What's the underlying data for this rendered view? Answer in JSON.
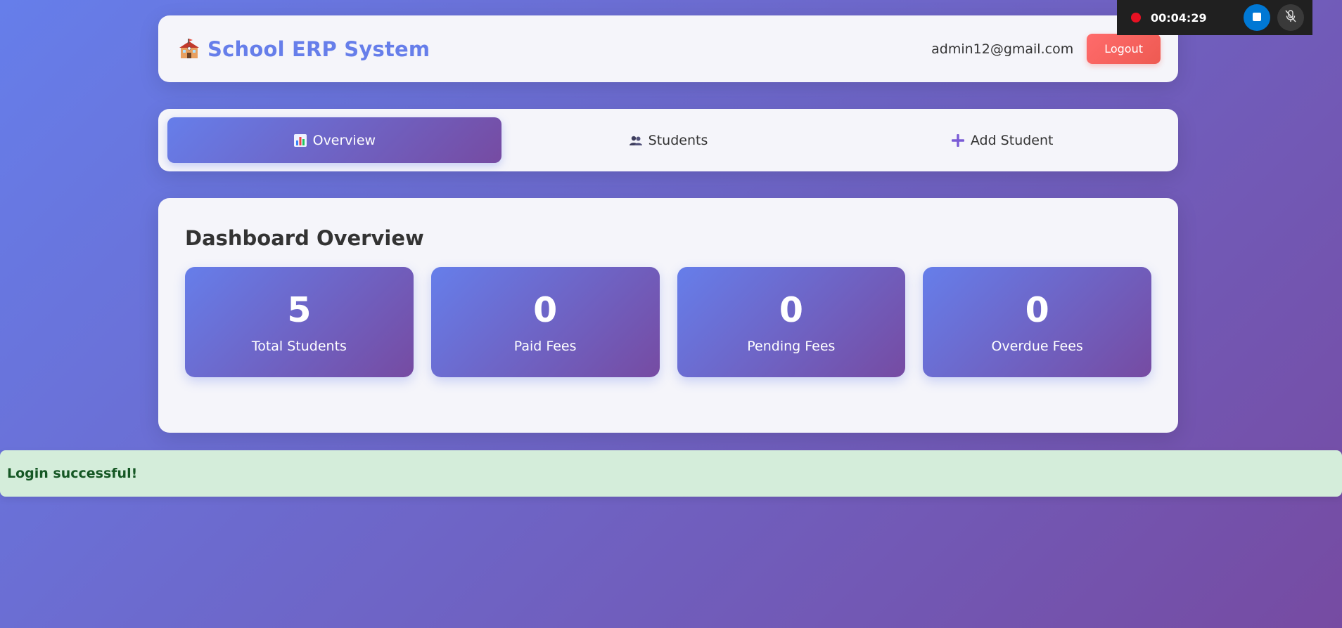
{
  "header": {
    "title": "School ERP System",
    "user_email": "admin12@gmail.com",
    "logout_label": "Logout",
    "brand_icon": "school-icon"
  },
  "tabs": [
    {
      "label": "Overview",
      "icon": "bar-chart-icon",
      "active": true
    },
    {
      "label": "Students",
      "icon": "users-icon",
      "active": false
    },
    {
      "label": "Add Student",
      "icon": "plus-icon",
      "active": false
    }
  ],
  "dashboard": {
    "title": "Dashboard Overview",
    "stats": [
      {
        "value": "5",
        "label": "Total Students"
      },
      {
        "value": "0",
        "label": "Paid Fees"
      },
      {
        "value": "0",
        "label": "Pending Fees"
      },
      {
        "value": "0",
        "label": "Overdue Fees"
      }
    ]
  },
  "toast": {
    "message": "Login successful!"
  },
  "recorder": {
    "time": "00:04:29"
  },
  "colors": {
    "accent": "#667eea",
    "accent_dark": "#764ba2",
    "logout": "#ee5a52",
    "toast_bg": "#d4edda",
    "toast_text": "#155724"
  }
}
